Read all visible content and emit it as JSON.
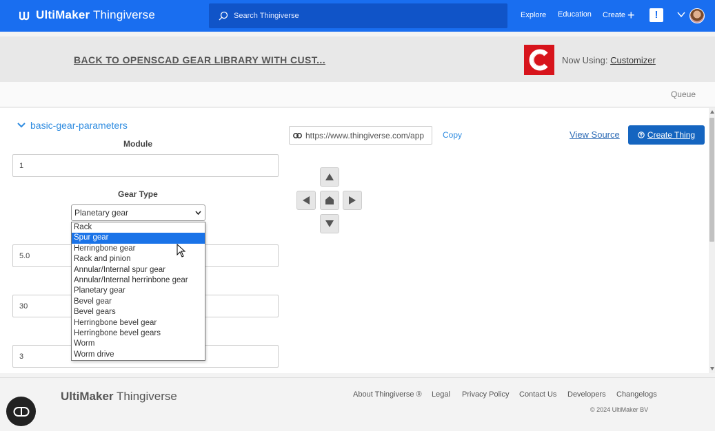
{
  "nav": {
    "brand_bold": "UltiMaker",
    "brand_rest": " Thingiverse",
    "search_placeholder": "Search Thingiverse",
    "explore": "Explore",
    "education": "Education",
    "create": "Create",
    "notification_badge": "!"
  },
  "header": {
    "back_link": "BACK TO OPENSCAD GEAR LIBRARY WITH CUST...",
    "now_using_label": "Now Using:",
    "now_using_app": "Customizer"
  },
  "queue": "Queue",
  "section": {
    "title": "basic-gear-parameters"
  },
  "fields": {
    "module_label": "Module",
    "module_value": "1",
    "gear_type_label": "Gear Type",
    "gear_type_selected": "Planetary gear",
    "field3_value": "5.0",
    "field4_value": "30",
    "field5_value": "3"
  },
  "dropdown_options": [
    "Rack",
    "Spur gear",
    "Herringbone gear",
    "Rack and pinion",
    "Annular/Internal spur gear",
    "Annular/Internal herrinbone gear",
    "Planetary gear",
    "Bevel gear",
    "Bevel gears",
    "Herringbone bevel gear",
    "Herringbone bevel gears",
    "Worm",
    "Worm drive"
  ],
  "dropdown_highlighted_index": 1,
  "toolbar": {
    "url": "https://www.thingiverse.com/app",
    "copy": "Copy",
    "view_source": "View Source",
    "create_thing": "Create Thing"
  },
  "footer": {
    "brand_bold": "UltiMaker",
    "brand_rest": " Thingiverse",
    "links": [
      "About Thingiverse ®",
      "Legal",
      "Privacy Policy",
      "Contact Us",
      "Developers",
      "Changelogs"
    ],
    "copyright": "© 2024 UltiMaker BV"
  },
  "colors": {
    "brand_blue": "#196ef0",
    "link_blue": "#2d8be0",
    "create_button": "#1565c0",
    "customizer_red": "#d7141c",
    "dropdown_highlight": "#1a73e8"
  }
}
